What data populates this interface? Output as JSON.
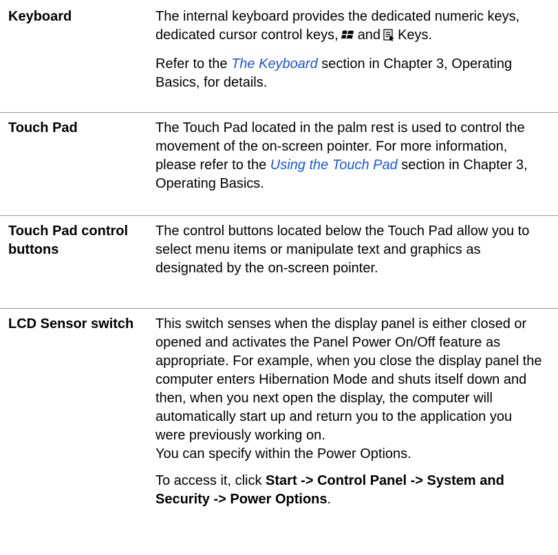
{
  "rows": [
    {
      "term": "Keyboard",
      "p1_a": "The internal keyboard provides the dedicated numeric keys, dedicated cursor control keys,",
      "p1_b": "and",
      "p1_c": "Keys.",
      "p2_a": "Refer to the",
      "p2_link": "The Keyboard",
      "p2_b": "section in Chapter 3, Operating Basics, for details.",
      "icons": [
        "windows-key-icon",
        "application-key-icon"
      ]
    },
    {
      "term": "Touch Pad",
      "p1_a": "The Touch Pad located in the palm rest is used to control the movement of the on-screen pointer. For more information, please refer to the",
      "p1_link": "Using the Touch Pad",
      "p1_b": "section in Chapter 3, Operating Basics."
    },
    {
      "term": "Touch Pad control buttons",
      "p1": "The control buttons located below the Touch Pad allow you to select menu items or manipulate text and graphics as designated by the on-screen pointer."
    },
    {
      "term": "LCD Sensor switch",
      "p1": "This switch senses when the display panel is either closed or opened and activates the Panel Power On/Off feature as appropriate. For example, when you close the display panel the computer enters Hibernation Mode and shuts itself down and then, when you next open the display, the computer will automatically start up and return you to the application you were previously working on.",
      "p1_extra": "You can specify within the Power Options.",
      "p2_a": "To access it, click",
      "p2_bold": "Start -> Control Panel -> System and Security -> Power Options",
      "p2_end": "."
    }
  ],
  "colors": {
    "link": "#1a56db",
    "divider": "#9a9a9a",
    "text": "#000000"
  }
}
